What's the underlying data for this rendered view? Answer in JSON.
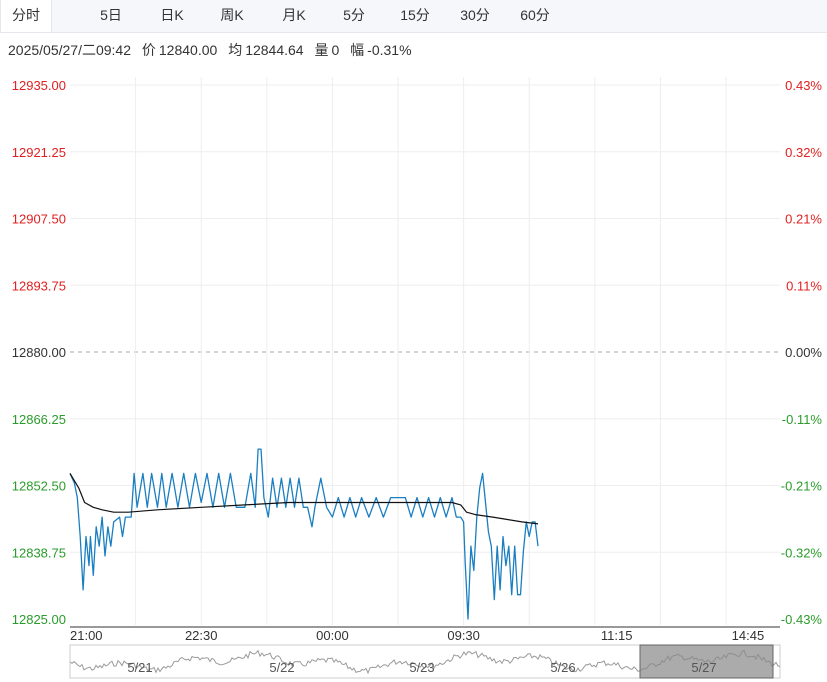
{
  "tabs": [
    {
      "label": "分时",
      "active": true
    },
    {
      "label": "5日",
      "active": false
    },
    {
      "label": "日K",
      "active": false
    },
    {
      "label": "周K",
      "active": false
    },
    {
      "label": "月K",
      "active": false
    },
    {
      "label": "5分",
      "active": false
    },
    {
      "label": "15分",
      "active": false
    },
    {
      "label": "30分",
      "active": false
    },
    {
      "label": "60分",
      "active": false
    }
  ],
  "info": {
    "datetime": "2025/05/27/二09:42",
    "price_label": "价",
    "price": "12840.00",
    "avg_label": "均",
    "avg": "12844.64",
    "vol_label": "量",
    "vol": "0",
    "chg_label": "幅",
    "chg": "-0.31%"
  },
  "colors": {
    "up": "#e02020",
    "down": "#2a9c2a",
    "neutral": "#333333",
    "price_line": "#1a7fc1",
    "avg_line": "#111111",
    "grid": "#eeeeee"
  },
  "chart_data": {
    "type": "line",
    "prev_close": 12880.0,
    "ylim": [
      12825.0,
      12935.0
    ],
    "left_ticks": [
      "12935.00",
      "12921.25",
      "12907.50",
      "12893.75",
      "12880.00",
      "12866.25",
      "12852.50",
      "12838.75",
      "12825.00"
    ],
    "right_ticks": [
      "0.43%",
      "0.32%",
      "0.21%",
      "0.11%",
      "0.00%",
      "-0.11%",
      "-0.21%",
      "-0.32%",
      "-0.43%"
    ],
    "x_ticks": [
      "21:00",
      "22:30",
      "00:00",
      "09:30",
      "11:15",
      "14:45"
    ],
    "x_tick_index": [
      0,
      90,
      180,
      270,
      375,
      465
    ],
    "total_minutes": 487,
    "series": [
      {
        "key": "price",
        "points": [
          [
            0,
            12855
          ],
          [
            3,
            12853
          ],
          [
            5,
            12850
          ],
          [
            7,
            12842
          ],
          [
            9,
            12831
          ],
          [
            11,
            12842
          ],
          [
            13,
            12836
          ],
          [
            14,
            12842
          ],
          [
            16,
            12834
          ],
          [
            18,
            12844
          ],
          [
            20,
            12840
          ],
          [
            22,
            12846
          ],
          [
            24,
            12838
          ],
          [
            26,
            12844
          ],
          [
            28,
            12840
          ],
          [
            30,
            12845
          ],
          [
            34,
            12846
          ],
          [
            36,
            12842
          ],
          [
            38,
            12846
          ],
          [
            42,
            12846
          ],
          [
            44,
            12855
          ],
          [
            46,
            12848
          ],
          [
            50,
            12855
          ],
          [
            53,
            12848
          ],
          [
            56,
            12855
          ],
          [
            60,
            12848
          ],
          [
            63,
            12855
          ],
          [
            66,
            12848
          ],
          [
            70,
            12855
          ],
          [
            74,
            12848
          ],
          [
            78,
            12855
          ],
          [
            82,
            12848
          ],
          [
            86,
            12855
          ],
          [
            90,
            12849
          ],
          [
            94,
            12855
          ],
          [
            98,
            12848
          ],
          [
            102,
            12855
          ],
          [
            106,
            12848
          ],
          [
            110,
            12855
          ],
          [
            114,
            12848
          ],
          [
            120,
            12848
          ],
          [
            124,
            12855
          ],
          [
            127,
            12848
          ],
          [
            129,
            12860
          ],
          [
            131,
            12860
          ],
          [
            133,
            12850
          ],
          [
            136,
            12846
          ],
          [
            139,
            12854
          ],
          [
            142,
            12848
          ],
          [
            145,
            12854
          ],
          [
            148,
            12848
          ],
          [
            151,
            12854
          ],
          [
            154,
            12848
          ],
          [
            157,
            12854
          ],
          [
            160,
            12848
          ],
          [
            163,
            12848
          ],
          [
            166,
            12844
          ],
          [
            168,
            12848
          ],
          [
            172,
            12854
          ],
          [
            176,
            12848
          ],
          [
            180,
            12846
          ],
          [
            184,
            12850
          ],
          [
            188,
            12846
          ],
          [
            192,
            12850
          ],
          [
            196,
            12846
          ],
          [
            200,
            12850
          ],
          [
            205,
            12846
          ],
          [
            210,
            12850
          ],
          [
            215,
            12846
          ],
          [
            220,
            12850
          ],
          [
            225,
            12850
          ],
          [
            230,
            12850
          ],
          [
            234,
            12846
          ],
          [
            238,
            12850
          ],
          [
            242,
            12846
          ],
          [
            246,
            12850
          ],
          [
            250,
            12846
          ],
          [
            254,
            12850
          ],
          [
            258,
            12846
          ],
          [
            262,
            12850
          ],
          [
            265,
            12846
          ],
          [
            268,
            12846
          ],
          [
            270,
            12845
          ],
          [
            271,
            12837
          ],
          [
            273,
            12825
          ],
          [
            275,
            12840
          ],
          [
            277,
            12835
          ],
          [
            279,
            12846
          ],
          [
            281,
            12852
          ],
          [
            283,
            12855
          ],
          [
            285,
            12849
          ],
          [
            287,
            12843
          ],
          [
            289,
            12840
          ],
          [
            291,
            12829
          ],
          [
            293,
            12840
          ],
          [
            295,
            12831
          ],
          [
            297,
            12842
          ],
          [
            299,
            12836
          ],
          [
            301,
            12840
          ],
          [
            303,
            12830
          ],
          [
            305,
            12840
          ],
          [
            307,
            12830
          ],
          [
            309,
            12830
          ],
          [
            311,
            12839
          ],
          [
            313,
            12845
          ],
          [
            315,
            12842
          ],
          [
            317,
            12845
          ],
          [
            319,
            12845
          ],
          [
            321,
            12840
          ]
        ]
      },
      {
        "key": "avg",
        "points": [
          [
            0,
            12855
          ],
          [
            6,
            12852
          ],
          [
            10,
            12849
          ],
          [
            16,
            12848
          ],
          [
            22,
            12847.5
          ],
          [
            30,
            12847
          ],
          [
            40,
            12847
          ],
          [
            60,
            12847.5
          ],
          [
            90,
            12848
          ],
          [
            120,
            12848.5
          ],
          [
            150,
            12849
          ],
          [
            180,
            12849
          ],
          [
            210,
            12849
          ],
          [
            240,
            12849
          ],
          [
            262,
            12849
          ],
          [
            268,
            12848.5
          ],
          [
            272,
            12847
          ],
          [
            278,
            12846.5
          ],
          [
            290,
            12846
          ],
          [
            300,
            12845.5
          ],
          [
            310,
            12845
          ],
          [
            321,
            12844.6
          ]
        ]
      }
    ],
    "navigator_labels": [
      "5/21",
      "5/22",
      "5/23",
      "5/26",
      "5/27"
    ]
  }
}
